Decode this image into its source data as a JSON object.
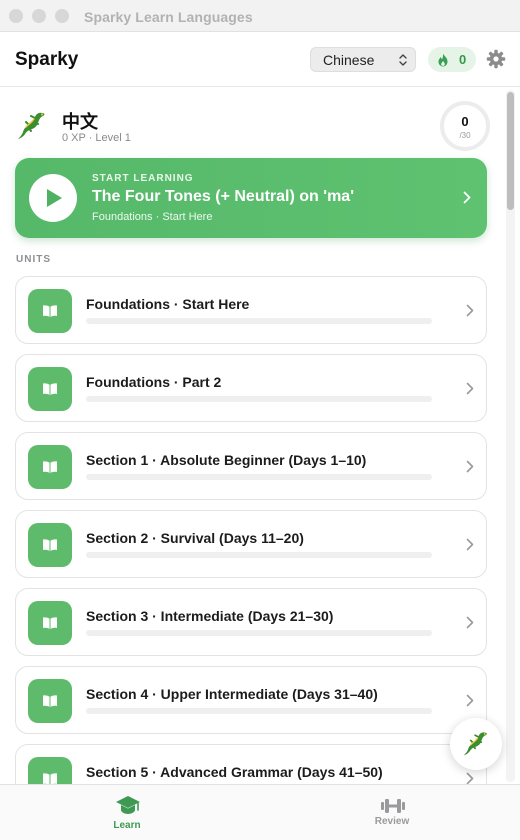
{
  "window": {
    "title": "Sparky Learn Languages"
  },
  "header": {
    "brand": "Sparky",
    "language_select": {
      "value": "Chinese",
      "options": [
        "Chinese"
      ]
    },
    "streak": {
      "count": "0",
      "icon": "flame-icon"
    },
    "settings_icon": "gear-icon"
  },
  "language": {
    "name": "中文",
    "meta": "0 XP · Level 1",
    "xp_ring": {
      "value": "0",
      "goal": "/30"
    }
  },
  "start_card": {
    "kicker": "START LEARNING",
    "title": "The Four Tones (+ Neutral) on 'ma'",
    "subtitle": "Foundations · Start Here"
  },
  "units_label": "UNITS",
  "units": [
    {
      "title": "Foundations · Start Here",
      "progress": 0
    },
    {
      "title": "Foundations · Part 2",
      "progress": 0
    },
    {
      "title": "Section 1 · Absolute Beginner (Days 1–10)",
      "progress": 0
    },
    {
      "title": "Section 2 · Survival (Days 11–20)",
      "progress": 0
    },
    {
      "title": "Section 3 · Intermediate (Days 21–30)",
      "progress": 0
    },
    {
      "title": "Section 4 · Upper Intermediate (Days 31–40)",
      "progress": 0
    },
    {
      "title": "Section 5 · Advanced Grammar (Days 41–50)",
      "progress": 0
    }
  ],
  "tabs": [
    {
      "label": "Learn",
      "icon": "graduation-cap-icon",
      "active": true
    },
    {
      "label": "Review",
      "icon": "dumbbell-icon",
      "active": false
    }
  ],
  "colors": {
    "accent": "#5dbb6b",
    "accent_dark": "#3e9a52",
    "streak_bg": "#e6f4e8"
  }
}
